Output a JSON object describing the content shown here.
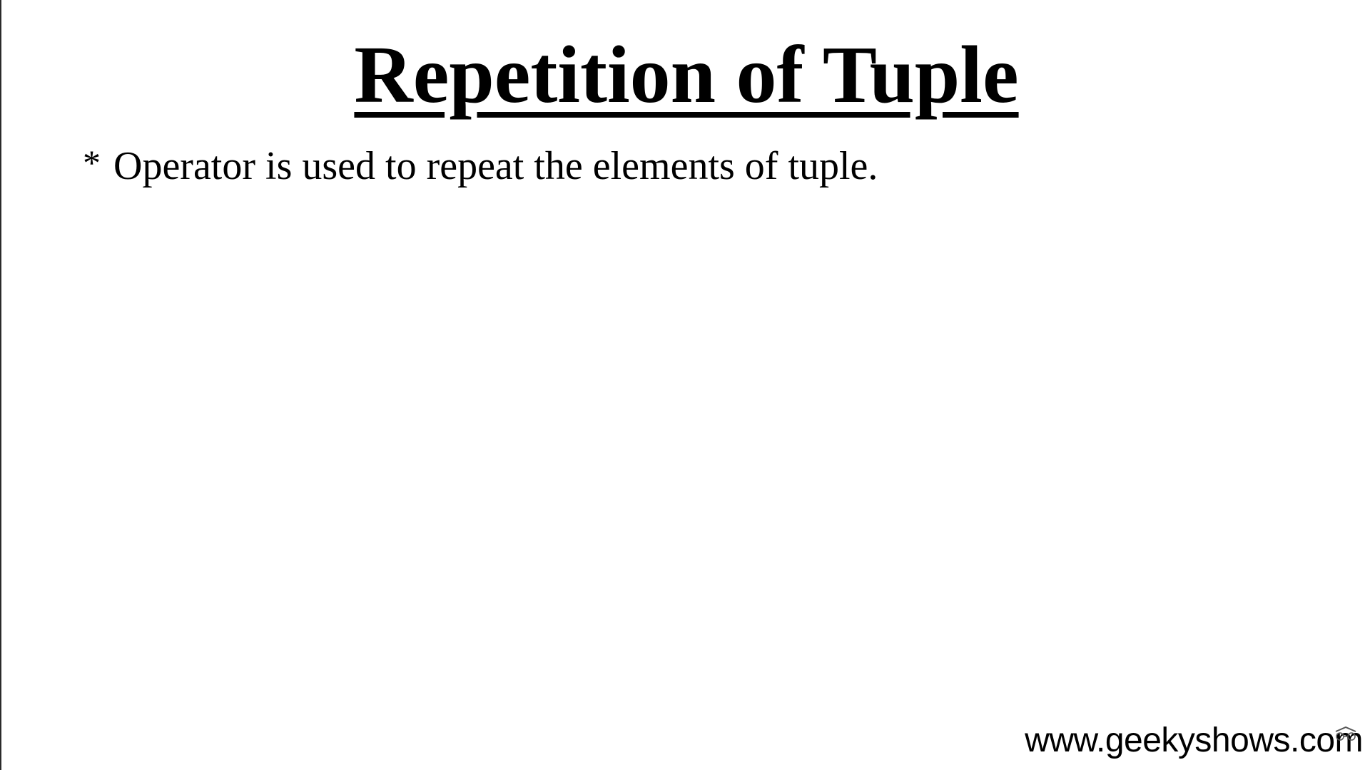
{
  "slide": {
    "title": "Repetition of Tuple",
    "bullets": [
      {
        "marker": "*",
        "text": "Operator is used to repeat the elements of tuple."
      }
    ],
    "watermark": "www.geekyshows.com"
  },
  "icons": {
    "corner": "player-overlay-icon"
  }
}
